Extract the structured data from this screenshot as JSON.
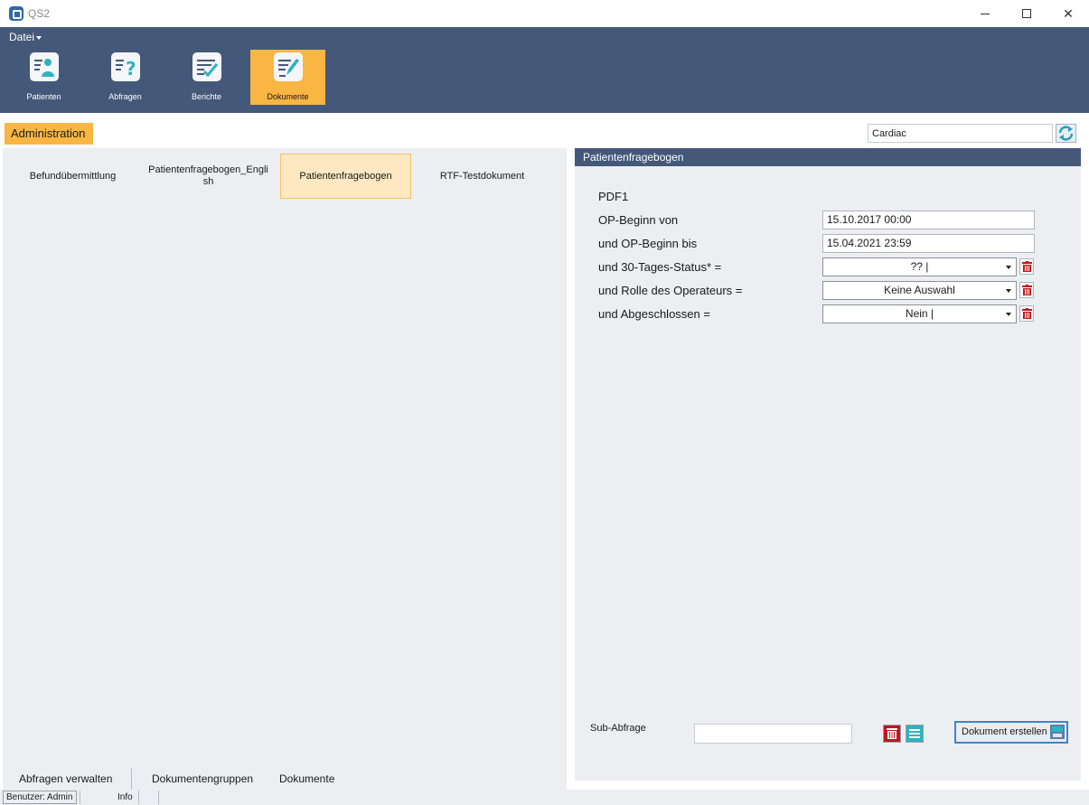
{
  "window": {
    "title": "QS2"
  },
  "menu": {
    "datei": "Datei"
  },
  "ribbon": {
    "buttons": [
      {
        "label": "Patienten",
        "icon": "patient-icon",
        "active": false
      },
      {
        "label": "Abfragen",
        "icon": "query-icon",
        "active": false
      },
      {
        "label": "Berichte",
        "icon": "report-icon",
        "active": false
      },
      {
        "label": "Dokumente",
        "icon": "document-edit-icon",
        "active": true
      }
    ]
  },
  "toolbar": {
    "admin_tab": "Administration",
    "search_value": "Cardiac"
  },
  "documents": [
    {
      "label": "Befundübermittlung",
      "selected": false
    },
    {
      "label": "Patientenfragebogen_English",
      "selected": false
    },
    {
      "label": "Patientenfragebogen",
      "selected": true
    },
    {
      "label": "RTF-Testdokument",
      "selected": false
    }
  ],
  "bottom_tabs": [
    "Abfragen verwalten",
    "Dokumentengruppen",
    "Dokumente"
  ],
  "panel": {
    "title": "Patientenfragebogen",
    "format": "PDF1",
    "rows": [
      {
        "label": "OP-Beginn  von",
        "value": "15.10.2017 00:00",
        "kind": "text"
      },
      {
        "label": "und OP-Beginn  bis",
        "value": "15.04.2021 23:59",
        "kind": "text"
      },
      {
        "label": "und 30-Tages-Status*  =",
        "value": "?? |",
        "kind": "select"
      },
      {
        "label": "und Rolle des Operateurs  =",
        "value": "Keine Auswahl",
        "kind": "select"
      },
      {
        "label": "und Abgeschlossen  =",
        "value": "Nein |",
        "kind": "select"
      }
    ],
    "sub_query_label": "Sub-Abfrage",
    "sub_query_value": "",
    "create_button": "Dokument erstellen"
  },
  "status": {
    "user": "Benutzer: Admin",
    "info": "Info"
  },
  "colors": {
    "ribbon": "#44587a",
    "accent": "#f9b642",
    "panel": "#eceef2",
    "trash": "#c0161c"
  }
}
